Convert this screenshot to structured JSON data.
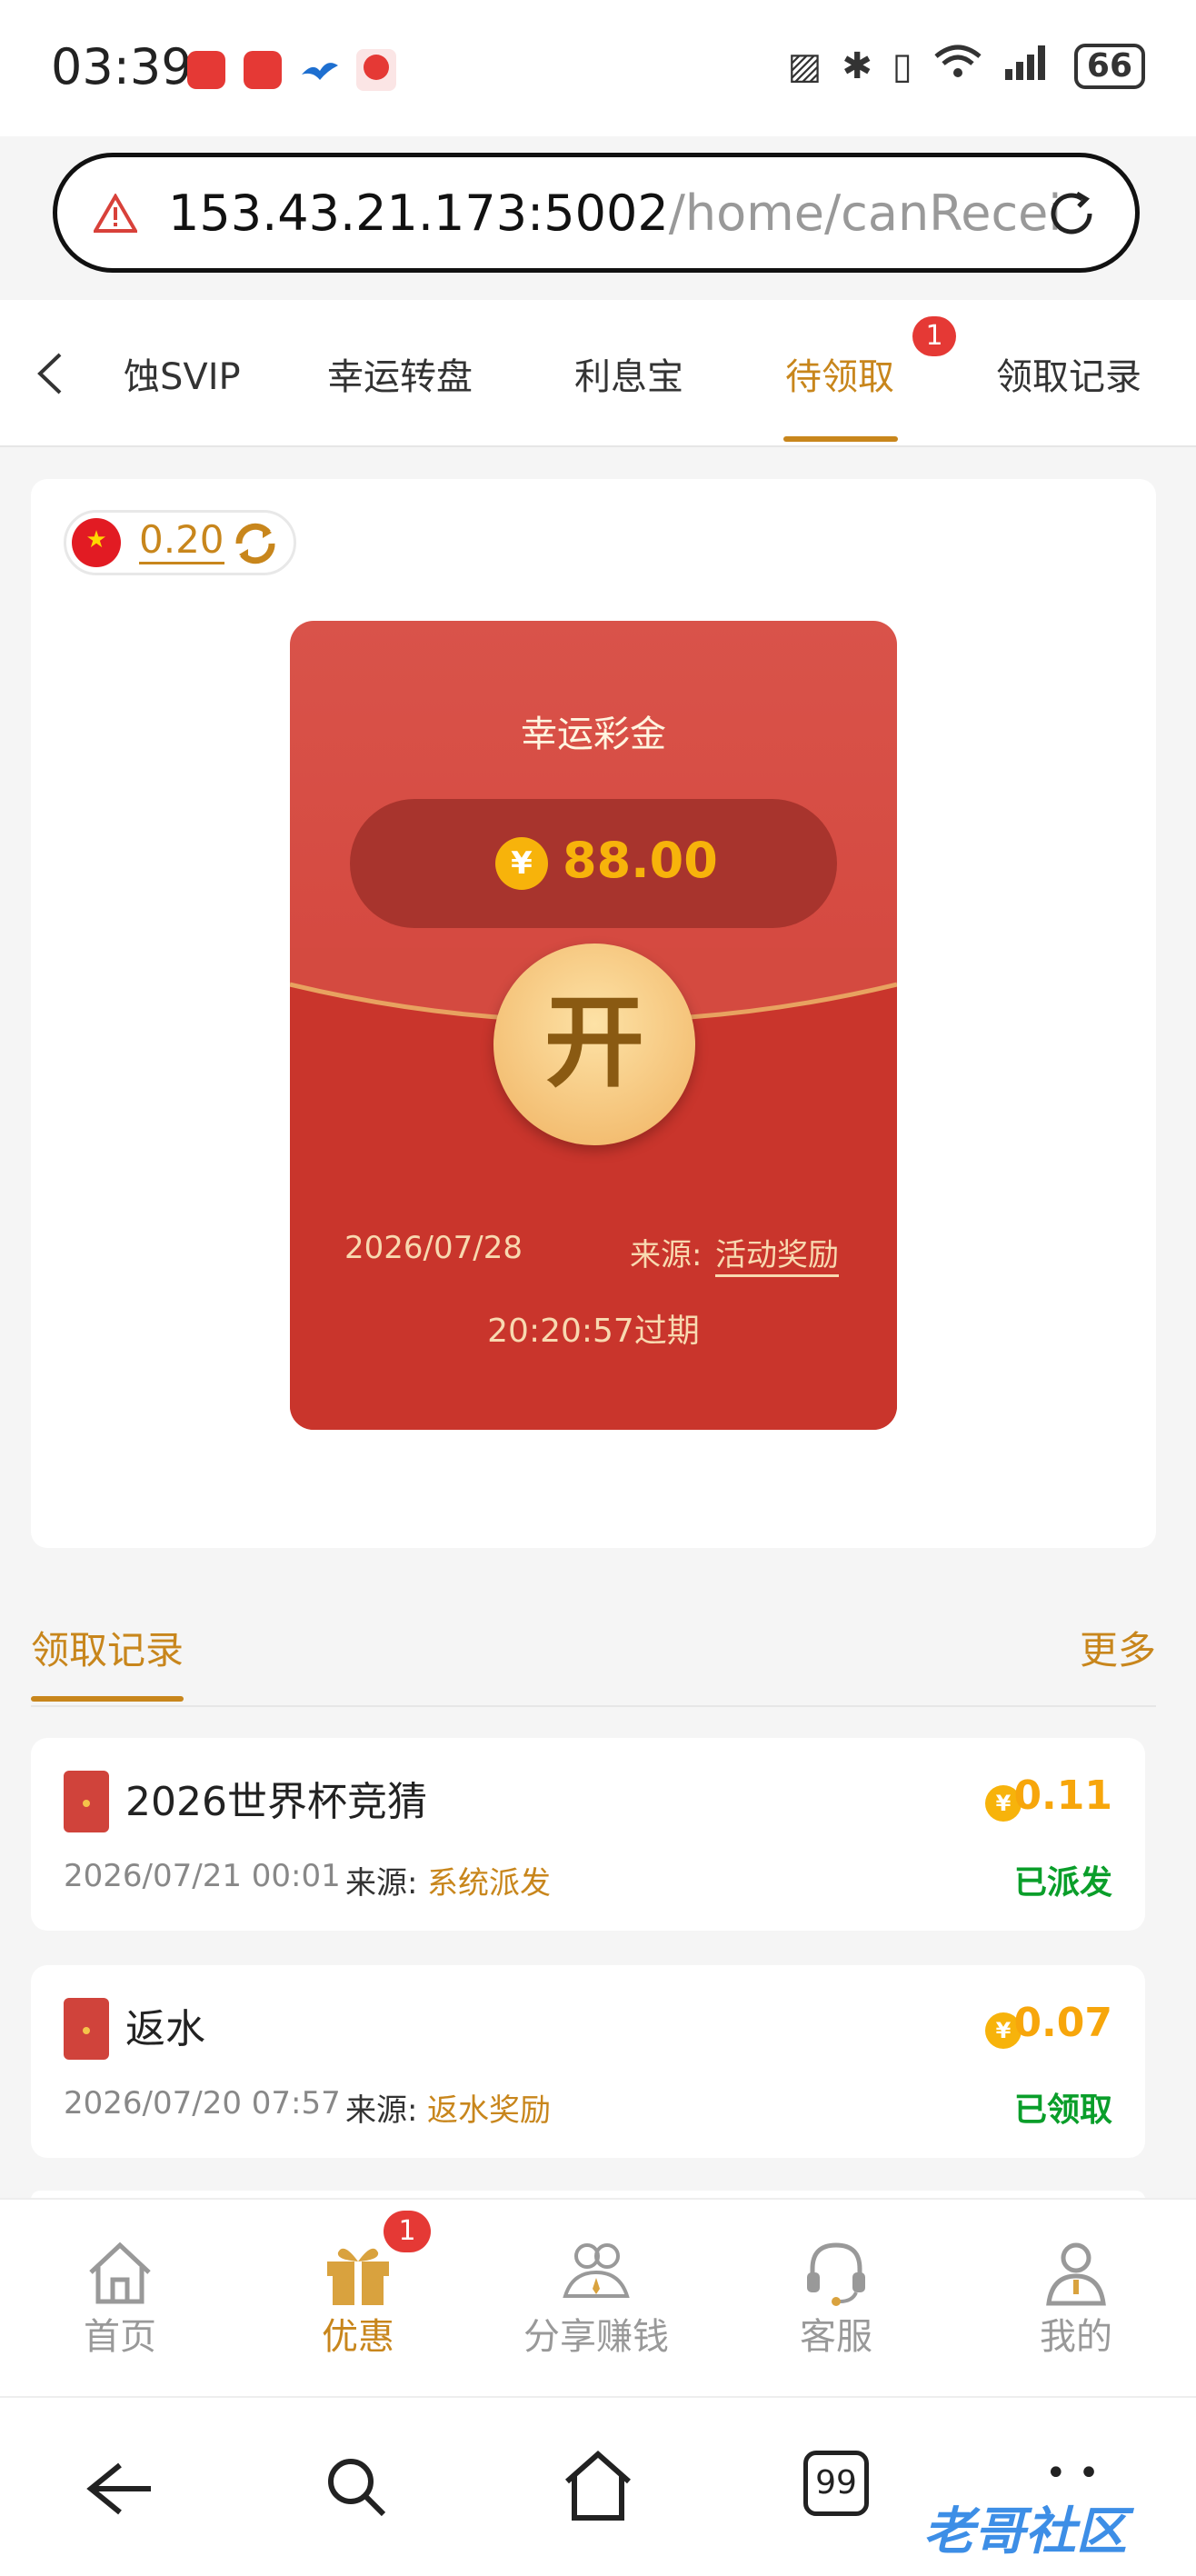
{
  "status_bar": {
    "time": "03:39",
    "battery": "66"
  },
  "browser": {
    "url_host": "153.43.21.173:5002",
    "url_path": "/home/canRecei"
  },
  "tabs": [
    {
      "label": "蚀SVIP"
    },
    {
      "label": "幸运转盘"
    },
    {
      "label": "利息宝"
    },
    {
      "label": "待领取",
      "badge": "1",
      "active": true
    },
    {
      "label": "领取记录"
    }
  ],
  "balance": {
    "value": "0.20"
  },
  "envelope": {
    "title": "幸运彩金",
    "currency_symbol": "¥",
    "amount": "88.00",
    "open_label": "开",
    "date": "2026/07/28",
    "source_label": "来源:",
    "source": "活动奖励",
    "expiry": "20:20:57过期"
  },
  "records_section": {
    "title": "领取记录",
    "more": "更多"
  },
  "records": [
    {
      "title": "2026世界杯竞猜",
      "amount": "0.11",
      "date": "2026/07/21 00:01",
      "source_label": "来源:",
      "source": "系统派发",
      "status": "已派发"
    },
    {
      "title": "返水",
      "amount": "0.07",
      "date": "2026/07/20 07:57",
      "source_label": "来源:",
      "source": "返水奖励",
      "status": "已领取"
    }
  ],
  "bottom_nav": [
    {
      "label": "首页",
      "icon": "home-icon"
    },
    {
      "label": "优惠",
      "icon": "gift-icon",
      "badge": "1",
      "active": true
    },
    {
      "label": "分享赚钱",
      "icon": "share-people-icon"
    },
    {
      "label": "客服",
      "icon": "headset-icon"
    },
    {
      "label": "我的",
      "icon": "user-icon"
    }
  ],
  "system_nav": {
    "tabs_count": "99"
  },
  "watermark": "老哥社区",
  "colors": {
    "accent": "#c8861c",
    "envelope_red": "#cf3c33",
    "coin": "#f7b30b",
    "success": "#0a9e2a",
    "badge": "#e53935"
  }
}
